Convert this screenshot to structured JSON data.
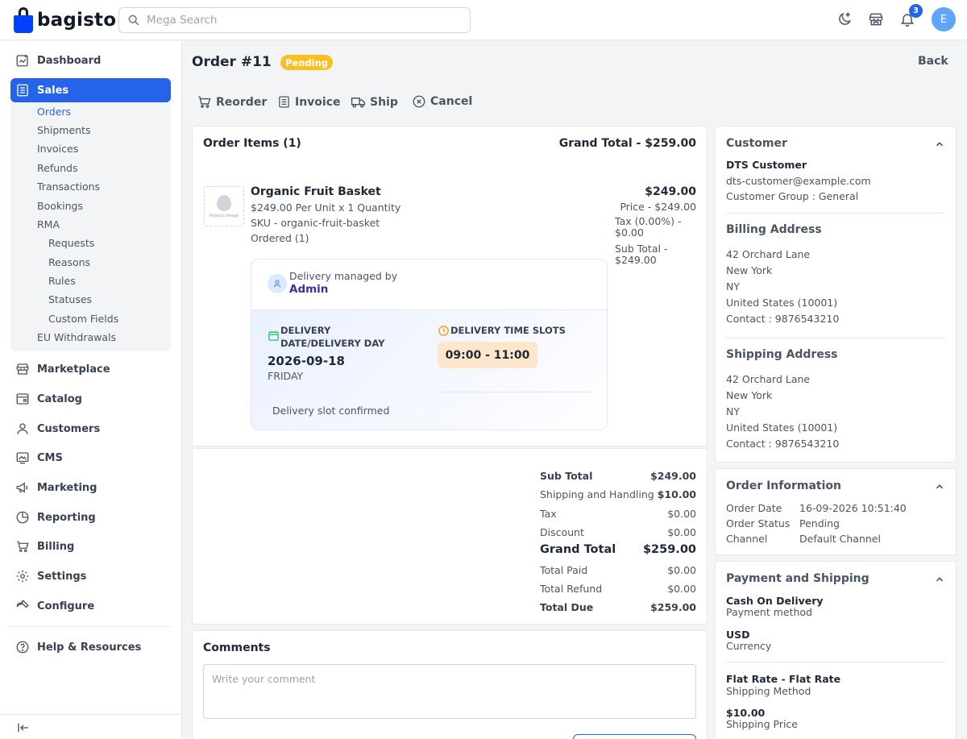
{
  "brand": {
    "name": "bagisto"
  },
  "search": {
    "placeholder": "Mega Search"
  },
  "header": {
    "notification_count": "3",
    "avatar_initial": "E"
  },
  "sidebar": {
    "items": [
      {
        "label": "Dashboard"
      },
      {
        "label": "Sales"
      },
      {
        "label": "Marketplace"
      },
      {
        "label": "Catalog"
      },
      {
        "label": "Customers"
      },
      {
        "label": "CMS"
      },
      {
        "label": "Marketing"
      },
      {
        "label": "Reporting"
      },
      {
        "label": "Billing"
      },
      {
        "label": "Settings"
      },
      {
        "label": "Configure"
      },
      {
        "label": "Help & Resources"
      }
    ],
    "sales_sub": [
      "Orders",
      "Shipments",
      "Invoices",
      "Refunds",
      "Transactions",
      "Bookings",
      "RMA",
      "Requests",
      "Reasons",
      "Rules",
      "Statuses",
      "Custom Fields",
      "EU Withdrawals"
    ]
  },
  "page": {
    "title": "Order #11",
    "status": "Pending",
    "back": "Back"
  },
  "actions": {
    "reorder": "Reorder",
    "invoice": "Invoice",
    "ship": "Ship",
    "cancel": "Cancel"
  },
  "order_items": {
    "title": "Order Items (1)",
    "grand_total": "Grand Total - $259.00",
    "image_label": "Product Image",
    "product": {
      "name": "Organic Fruit Basket",
      "per_unit": "$249.00 Per Unit x 1 Quantity",
      "sku": "SKU - organic-fruit-basket",
      "ordered": "Ordered (1)",
      "price_main": "$249.00",
      "price_line": "Price - $249.00",
      "tax_line1": "Tax (0.00%) -",
      "tax_line2": "$0.00",
      "subtotal_line1": "Sub Total -",
      "subtotal_line2": "$249.00"
    },
    "delivery": {
      "managed_by": "Delivery managed by",
      "manager": "Admin",
      "date_label_1": "DELIVERY",
      "date_label_2": "DATE/DELIVERY DAY",
      "date": "2026-09-18",
      "day": "FRIDAY",
      "slots_label": "DELIVERY TIME SLOTS",
      "slot": "09:00 - 11:00",
      "confirmed": "Delivery slot confirmed"
    }
  },
  "totals": [
    {
      "label": "Sub Total",
      "value": "$249.00"
    },
    {
      "label": "Shipping and Handling",
      "value": "$10.00"
    },
    {
      "label": "Tax",
      "value": "$0.00"
    },
    {
      "label": "Discount",
      "value": "$0.00"
    },
    {
      "label": "Grand Total",
      "value": "$259.00"
    },
    {
      "label": "Total Paid",
      "value": "$0.00"
    },
    {
      "label": "Total Refund",
      "value": "$0.00"
    },
    {
      "label": "Total Due",
      "value": "$259.00"
    }
  ],
  "comments": {
    "title": "Comments",
    "placeholder": "Write your comment"
  },
  "customer": {
    "title": "Customer",
    "name": "DTS Customer",
    "email": "dts-customer@example.com",
    "group": "Customer Group : General"
  },
  "billing": {
    "title": "Billing Address",
    "lines": [
      "42 Orchard Lane",
      "New York",
      "NY",
      "United States (10001)",
      "Contact : 9876543210"
    ]
  },
  "shipping": {
    "title": "Shipping Address",
    "lines": [
      "42 Orchard Lane",
      "New York",
      "NY",
      "United States (10001)",
      "Contact : 9876543210"
    ]
  },
  "order_info": {
    "title": "Order Information",
    "rows": [
      {
        "label": "Order Date",
        "value": "16-09-2026 10:51:40"
      },
      {
        "label": "Order Status",
        "value": "Pending"
      },
      {
        "label": "Channel",
        "value": "Default Channel"
      }
    ]
  },
  "payment": {
    "title": "Payment and Shipping",
    "method": "Cash On Delivery",
    "method_label": "Payment method",
    "currency": "USD",
    "currency_label": "Currency",
    "shipping_method": "Flat Rate - Flat Rate",
    "shipping_method_label": "Shipping Method",
    "shipping_price": "$10.00",
    "shipping_price_label": "Shipping Price"
  },
  "colors": {
    "accent": "#2563eb",
    "pending": "#fbbf24",
    "slot_bg": "#fde6cc",
    "calendar": "#22c55e",
    "clock": "#f59e0b"
  }
}
